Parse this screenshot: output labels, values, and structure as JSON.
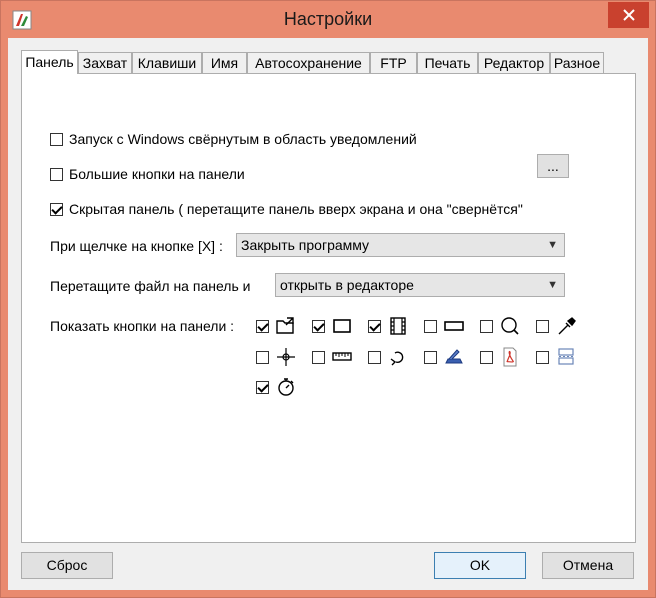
{
  "window": {
    "title": "Настройки",
    "accent": "#e98a6f",
    "close_color": "#c9412e"
  },
  "tabs": [
    {
      "label": "Панель",
      "active": true
    },
    {
      "label": "Захват"
    },
    {
      "label": "Клавиши"
    },
    {
      "label": "Имя"
    },
    {
      "label": "Автосохранение"
    },
    {
      "label": "FTP"
    },
    {
      "label": "Печать"
    },
    {
      "label": "Редактор"
    },
    {
      "label": "Разное"
    }
  ],
  "panel": {
    "options": [
      {
        "label": "Запуск с Windows свёрнутым в область уведомлений",
        "checked": false
      },
      {
        "label": "Большие кнопки на панели",
        "checked": false
      },
      {
        "label": "Скрытая панель ( перетащите панель вверх экрана и она \"свернётся\"",
        "checked": true
      }
    ],
    "dots_button": "...",
    "close_click_label": "При щелчке на кнопке [X] :",
    "close_click_value": "Закрыть программу",
    "drag_file_label": "Перетащите файл на панель и",
    "drag_file_value": "открыть в редакторе",
    "show_buttons_label": "Показать кнопки на панели :",
    "panel_buttons": [
      {
        "icon": "open-folder-icon",
        "checked": true
      },
      {
        "icon": "rectangle-capture-icon",
        "checked": true
      },
      {
        "icon": "film-video-icon",
        "checked": true
      },
      {
        "icon": "window-capture-icon",
        "checked": false
      },
      {
        "icon": "magnifier-icon",
        "checked": false
      },
      {
        "icon": "color-picker-icon",
        "checked": false
      },
      {
        "icon": "crosshair-icon",
        "checked": false
      },
      {
        "icon": "ruler-icon",
        "checked": false
      },
      {
        "icon": "undo-arrow-icon",
        "checked": false
      },
      {
        "icon": "scanner-icon",
        "checked": false
      },
      {
        "icon": "pdf-icon",
        "checked": false
      },
      {
        "icon": "scroll-capture-icon",
        "checked": false
      },
      {
        "icon": "timer-icon",
        "checked": true
      }
    ]
  },
  "footer": {
    "reset": "Сброс",
    "ok": "OK",
    "cancel": "Отмена"
  }
}
